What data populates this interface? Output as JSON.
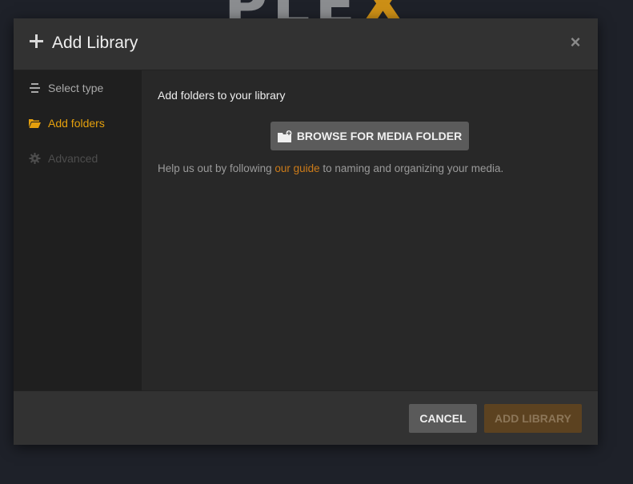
{
  "background": {
    "logo_text": "PLEX",
    "logo_main": "PLE",
    "logo_x": "X"
  },
  "dialog": {
    "title": "Add Library",
    "header_icon": "plus-icon",
    "close_icon": "close-icon",
    "close_glyph": "×"
  },
  "sidebar": {
    "items": [
      {
        "label": "Select type",
        "icon": "list-icon",
        "state": "visited"
      },
      {
        "label": "Add folders",
        "icon": "folder-open-icon",
        "state": "active"
      },
      {
        "label": "Advanced",
        "icon": "gear-icon",
        "state": "disabled"
      }
    ]
  },
  "content": {
    "title": "Add folders to your library",
    "browse_button": {
      "label": "BROWSE FOR MEDIA FOLDER",
      "icon": "folder-add-icon"
    },
    "help": {
      "before": "Help us out by following ",
      "link": "our guide",
      "after": " to naming and organizing your media."
    }
  },
  "footer": {
    "cancel_label": "CANCEL",
    "add_label": "ADD LIBRARY",
    "add_state": "disabled"
  },
  "colors": {
    "accent": "#e5a00d",
    "link": "#cc7b19",
    "background": "#1e2129",
    "modal": "#282828"
  }
}
